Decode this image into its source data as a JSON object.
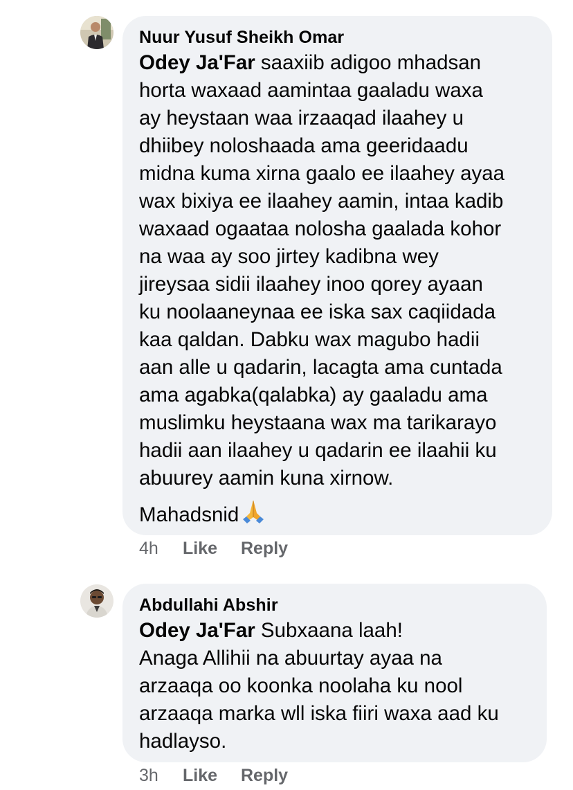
{
  "comments": [
    {
      "author": "Nuur Yusuf Sheikh Omar",
      "mention": "Odey Ja'Far",
      "text_lines": [
        " saaxiib adigoo mhadsan",
        "horta waxaad aamintaa gaaladu waxa",
        "ay heystaan waa irzaaqad ilaahey u",
        "dhiibey noloshaada ama geeridaadu",
        "midna kuma xirna gaalo ee ilaahey ayaa",
        "wax bixiya ee ilaahey aamin, intaa kadib",
        "waxaad ogaataa nolosha gaalada kohor",
        "na waa ay soo jirtey kadibna wey",
        "jireysaa sidii ilaahey inoo qorey ayaan",
        "ku noolaaneynaa ee iska sax caqiidada",
        "kaa qaldan. Dabku wax magubo hadii",
        "aan alle u qadarin, lacagta ama cuntada",
        "ama agabka(qalabka) ay gaaladu ama",
        "muslimku heystaana wax ma tarikarayo",
        "hadii aan ilaahey u qadarin ee ilaahii ku",
        "abuurey aamin kuna xirnow."
      ],
      "second_paragraph": "Mahadsnid",
      "emoji": "folded-hands-emoji",
      "time": "4h",
      "like_label": "Like",
      "reply_label": "Reply"
    },
    {
      "author": "Abdullahi Abshir",
      "mention": "Odey Ja'Far",
      "text_lines": [
        " Subxaana laah!",
        "Anaga Allihii na abuurtay ayaa na",
        "arzaaqa oo koonka noolaha ku nool",
        "arzaaqa marka wll iska fiiri waxa aad ku",
        "hadlayso."
      ],
      "time": "3h",
      "like_label": "Like",
      "reply_label": "Reply"
    }
  ]
}
